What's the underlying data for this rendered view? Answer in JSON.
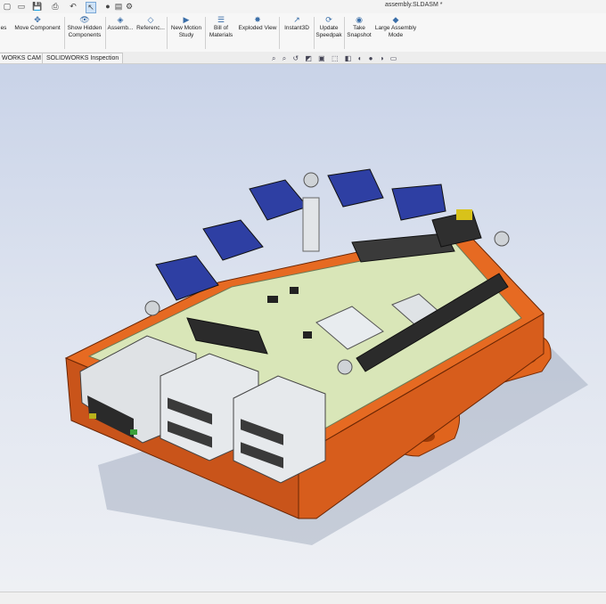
{
  "window": {
    "document_title": "assembly.SLDASM *"
  },
  "quick_access": [
    {
      "icon": "new-file-icon",
      "glyph": "▢"
    },
    {
      "icon": "open-folder-icon",
      "glyph": "📁"
    },
    {
      "icon": "save-icon",
      "glyph": "💾"
    },
    {
      "icon": "print-icon",
      "glyph": "⎙"
    },
    {
      "icon": "undo-icon",
      "glyph": "↶"
    },
    {
      "icon": "select-icon",
      "glyph": "↖"
    },
    {
      "icon": "rebuild-icon",
      "glyph": "●"
    },
    {
      "icon": "file-properties-icon",
      "glyph": "▤"
    },
    {
      "icon": "options-gear-icon",
      "glyph": "⚙"
    }
  ],
  "ribbon": {
    "buttons": [
      {
        "id": "insert-components",
        "label": "es",
        "glyph": ""
      },
      {
        "id": "move-component",
        "label": "Move Component",
        "glyph": "✥"
      },
      {
        "id": "show-hidden-components",
        "label": "Show Hidden Components",
        "glyph": "👁"
      },
      {
        "id": "assembly-features",
        "label": "Assemb...",
        "glyph": "◈"
      },
      {
        "id": "reference-geometry",
        "label": "Referenc...",
        "glyph": "◇"
      },
      {
        "id": "new-motion-study",
        "label": "New Motion Study",
        "glyph": "▶"
      },
      {
        "id": "bill-of-materials",
        "label": "Bill of Materials",
        "glyph": "☰"
      },
      {
        "id": "exploded-view",
        "label": "Exploded View",
        "glyph": "✸"
      },
      {
        "id": "instant3d",
        "label": "Instant3D",
        "glyph": "↗"
      },
      {
        "id": "update-speedpak",
        "label": "Update Speedpak",
        "glyph": "⟳"
      },
      {
        "id": "take-snapshot",
        "label": "Take Snapshot",
        "glyph": "◉"
      },
      {
        "id": "large-assembly-mode",
        "label": "Large Assembly Mode",
        "glyph": "◆"
      }
    ]
  },
  "tabs": [
    {
      "label": "WORKS CAM"
    },
    {
      "label": "SOLIDWORKS Inspection"
    }
  ],
  "heads_up_toolbar": [
    {
      "icon": "zoom-to-fit-icon",
      "glyph": "⌕"
    },
    {
      "icon": "zoom-area-icon",
      "glyph": "⌕"
    },
    {
      "icon": "previous-view-icon",
      "glyph": "↺"
    },
    {
      "icon": "section-view-icon",
      "glyph": "◩"
    },
    {
      "icon": "dynamic-annotation-icon",
      "glyph": "▣"
    },
    {
      "icon": "view-orientation-icon",
      "glyph": "⬚"
    },
    {
      "icon": "display-style-icon",
      "glyph": "◧"
    },
    {
      "icon": "hide-show-items-icon",
      "glyph": "◐"
    },
    {
      "icon": "edit-appearance-icon",
      "glyph": "●"
    },
    {
      "icon": "apply-scene-icon",
      "glyph": "◑"
    },
    {
      "icon": "view-settings-icon",
      "glyph": "▭"
    }
  ],
  "colors": {
    "enclosure": "#e0641d",
    "enclosure_shadow": "#a9420c",
    "pcb": "#d9e6b8",
    "connector_blue": "#2e3fa3",
    "metal": "#d7dbe0",
    "viewport_top": "#c9d3e8",
    "viewport_bottom": "#eef0f4"
  }
}
